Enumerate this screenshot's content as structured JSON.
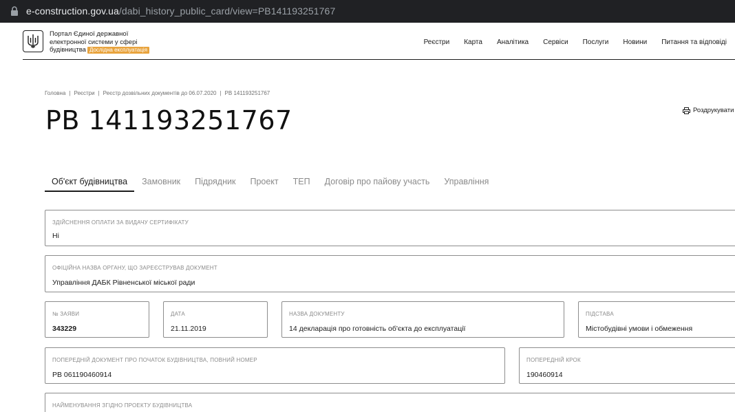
{
  "browser": {
    "url_host": "e-construction.gov.ua",
    "url_path": "/dabi_history_public_card/view=PB141193251767"
  },
  "header": {
    "portal_line1": "Портал Єдиної державної",
    "portal_line2": "електронної системи у сфері",
    "portal_line3": "будівництва",
    "badge": "Дослідна експлуатація",
    "nav": [
      "Реєстри",
      "Карта",
      "Аналітика",
      "Сервіси",
      "Послуги",
      "Новини",
      "Питання та відповіді"
    ]
  },
  "breadcrumb": [
    "Головна",
    "Реєстри",
    "Реєстр дозвільних документів до 06.07.2020",
    "РВ 141193251767"
  ],
  "page": {
    "title": "РВ 141193251767",
    "print_label": "Роздрукувати"
  },
  "tabs": [
    "Об'єкт будівництва",
    "Замовник",
    "Підрядник",
    "Проект",
    "ТЕП",
    "Договір про пайову участь",
    "Управління"
  ],
  "fields": {
    "payment": {
      "label": "Здійснення оплати за видачу сертифікату",
      "value": "Ні"
    },
    "authority": {
      "label": "Офіційна назва органу, що зареєстрував документ",
      "value": "Управління ДАБК Рівненської міської ради"
    },
    "app_number": {
      "label": "№ заяви",
      "value": "343229"
    },
    "date": {
      "label": "Дата",
      "value": "21.11.2019"
    },
    "doc_name": {
      "label": "Назва документу",
      "value": "14 декларація про готовність об'єкта до експлуатації"
    },
    "basis": {
      "label": "Підстава",
      "value": "Містобудівні умови і обмеження"
    },
    "prev_doc": {
      "label": "Попередній документ про початок будівництва, повний номер",
      "value": "РВ 061190460914"
    },
    "prev_step": {
      "label": "Попередній крок",
      "value": "190460914"
    },
    "project_name": {
      "label": "Найменування згідно проекту будівництва",
      "value": ""
    }
  }
}
